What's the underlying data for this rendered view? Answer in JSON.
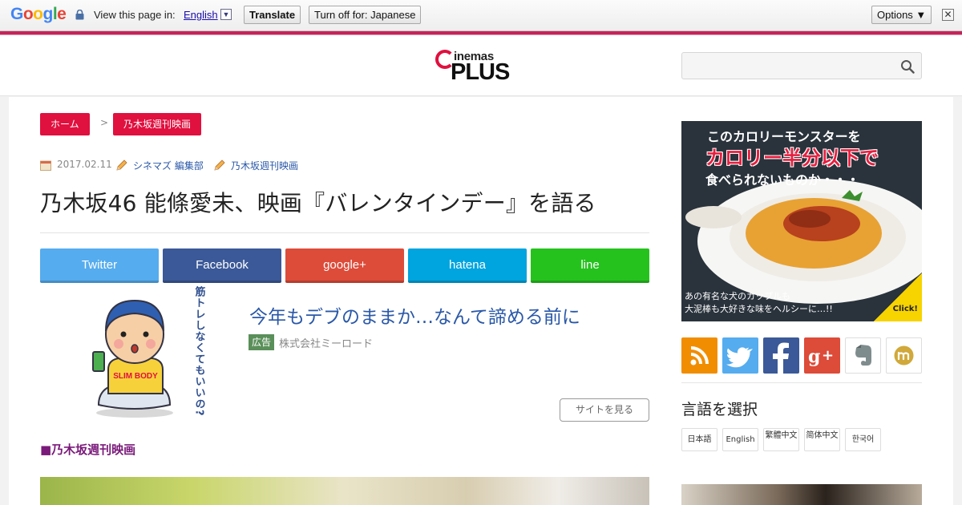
{
  "translate_bar": {
    "logo_letters": [
      {
        "ch": "G",
        "color": "#4285f4"
      },
      {
        "ch": "o",
        "color": "#ea4335"
      },
      {
        "ch": "o",
        "color": "#fbbc05"
      },
      {
        "ch": "g",
        "color": "#4285f4"
      },
      {
        "ch": "l",
        "color": "#34a853"
      },
      {
        "ch": "e",
        "color": "#ea4335"
      }
    ],
    "view_text": "View this page in:",
    "language": "English",
    "dropdown_glyph": "▼",
    "translate_label": "Translate",
    "turn_off_label": "Turn off for: Japanese",
    "options_label": "Options ▼",
    "close_glyph": "✕"
  },
  "header": {
    "logo_top": "inemas",
    "logo_bottom": "PLUS"
  },
  "breadcrumb": {
    "home": "ホーム",
    "separator": ">",
    "category": "乃木坂週刊映画"
  },
  "article": {
    "date": "2017.02.11",
    "author": "シネマズ 編集部",
    "tag": "乃木坂週刊映画",
    "title": "乃木坂46 能條愛未、映画『バレンタインデー』を語る",
    "section_heading": "■乃木坂週刊映画"
  },
  "share_buttons": [
    {
      "label": "Twitter",
      "color": "#55acee"
    },
    {
      "label": "Facebook",
      "color": "#3b5998"
    },
    {
      "label": "google+",
      "color": "#dd4b39"
    },
    {
      "label": "hatena",
      "color": "#00a4de"
    },
    {
      "label": "line",
      "color": "#25c21e"
    }
  ],
  "ad": {
    "vertical_text": "筋トレしなくてもいいの?",
    "shirt_text": "SLIM BODY",
    "title": "今年もデブのままか…なんて諦める前に",
    "badge": "広告",
    "sponsor": "株式会社ミーロード",
    "cta": "サイトを見る"
  },
  "sidebar": {
    "banner": {
      "line1": "このカロリーモンスターを",
      "line2": "カロリー半分以下で",
      "line3": "食べられないものか・・・",
      "line4": "あの有名な犬のカップルも",
      "line5": "大泥棒も大好きな味をヘルシーに…!!",
      "click": "Click!"
    },
    "social_icons": [
      {
        "name": "rss-icon",
        "color": "#f18d00"
      },
      {
        "name": "twitter-icon",
        "color": "#55acee"
      },
      {
        "name": "facebook-icon",
        "color": "#3b5998"
      },
      {
        "name": "googleplus-icon",
        "color": "#dd4b39"
      },
      {
        "name": "evernote-icon",
        "color": "#ffffff"
      },
      {
        "name": "mixi-icon",
        "color": "#ffffff"
      }
    ],
    "lang_heading": "言語を選択",
    "languages": [
      "日本語",
      "English",
      "繁體中文",
      "简体中文",
      "한국어"
    ]
  }
}
